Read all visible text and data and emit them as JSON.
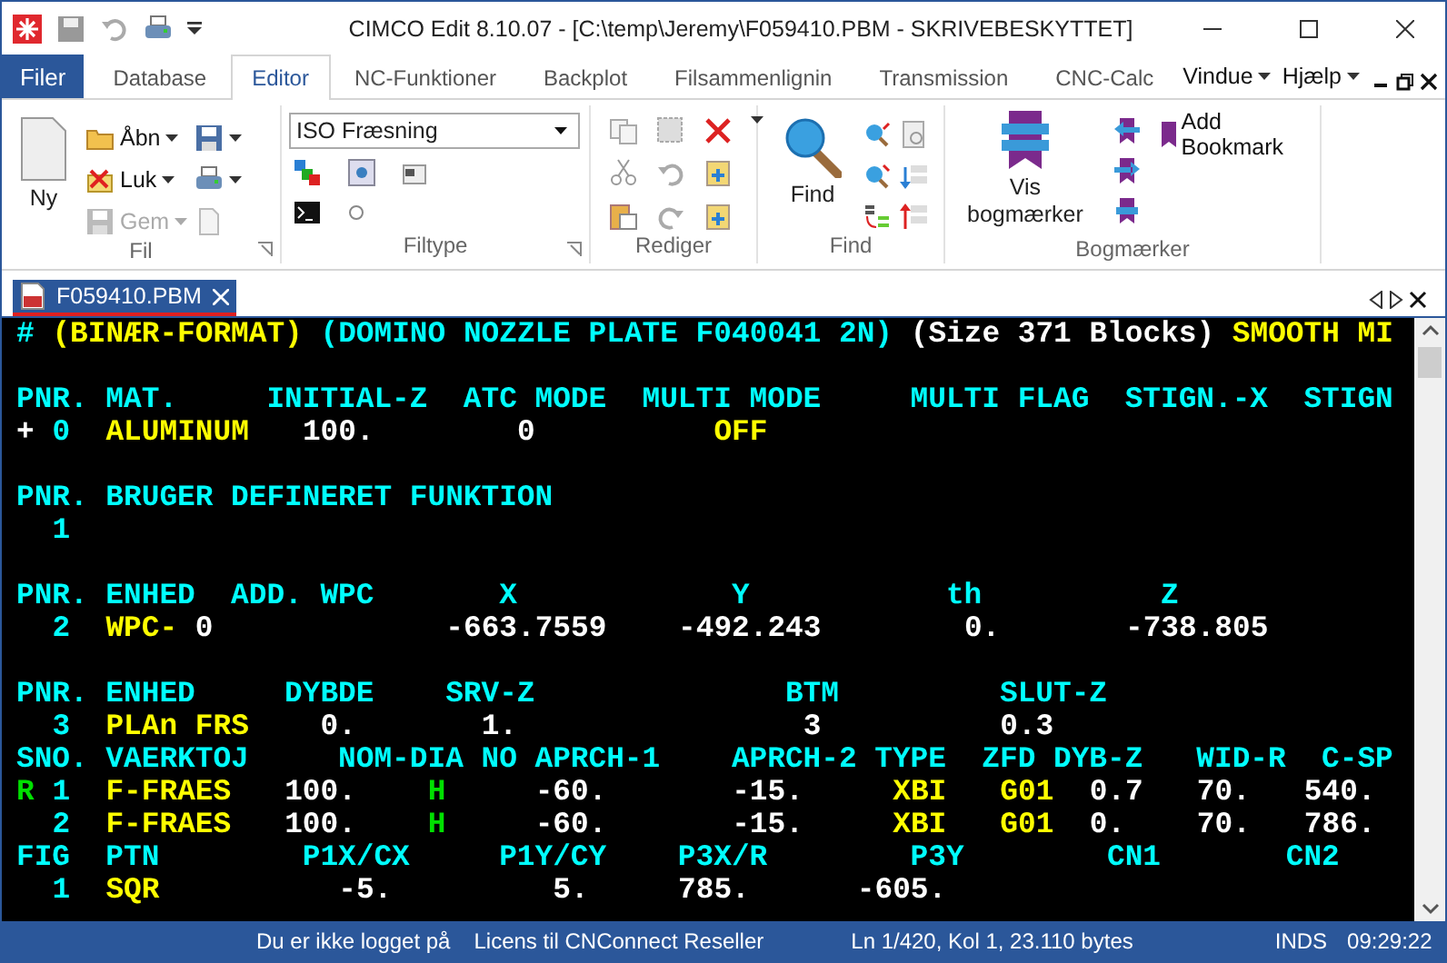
{
  "window": {
    "title": "CIMCO Edit 8.10.07 - [C:\\temp\\Jeremy\\F059410.PBM - SKRIVEBESKYTTET]"
  },
  "ribbon": {
    "file_tab": "Filer",
    "tabs": [
      {
        "label": "Database",
        "selected": false
      },
      {
        "label": "Editor",
        "selected": true
      },
      {
        "label": "NC-Funktioner",
        "selected": false
      },
      {
        "label": "Backplot",
        "selected": false
      },
      {
        "label": "Filsammenlignin",
        "selected": false
      },
      {
        "label": "Transmission",
        "selected": false
      },
      {
        "label": "CNC-Calc",
        "selected": false
      }
    ],
    "menus": [
      "Vindue",
      "Hjælp"
    ],
    "fil": {
      "label": "Fil",
      "new_button": "Ny",
      "buttons": [
        {
          "label": "Åbn",
          "disabled": false
        },
        {
          "label": "Luk",
          "disabled": false
        },
        {
          "label": "Gem",
          "disabled": true
        }
      ]
    },
    "filtype": {
      "label": "Filtype",
      "dropdown_value": "ISO Fræsning"
    },
    "rediger": {
      "label": "Rediger"
    },
    "find": {
      "label": "Find",
      "button": "Find"
    },
    "bogmaerker": {
      "label": "Bogmærker",
      "show_button": [
        "Vis",
        "bogmærker"
      ],
      "add_button": "Add Bookmark"
    }
  },
  "document_tabs": [
    {
      "label": "F059410.PBM",
      "selected": true
    }
  ],
  "editor": {
    "lines": [
      {
        "kind": "code",
        "segments": [
          {
            "text": "#",
            "color": "#00ffff"
          },
          {
            "text": " (BINÆR-FORMAT)",
            "color": "#ffff00"
          },
          {
            "text": " (DOMINO NOZZLE PLATE F040041 2N)",
            "color": "#00ffff"
          },
          {
            "text": " (Size 371 Blocks)",
            "color": "#ffffff"
          },
          {
            "text": " SMOOTH MI",
            "color": "#ffff00"
          }
        ]
      },
      {
        "kind": "blank"
      },
      {
        "kind": "code",
        "segments": [
          {
            "text": "PNR. MAT.     INITIAL-Z  ATC MODE  MULTI MODE     MULTI FLAG  STIGN.-X  STIGN",
            "color": "#00ffff"
          }
        ]
      },
      {
        "kind": "code",
        "segments": [
          {
            "text": "+",
            "color": "#ffffff"
          },
          {
            "text": " 0",
            "color": "#00ffff"
          },
          {
            "text": "  ALUMINUM",
            "color": "#ffff00"
          },
          {
            "text": "   100.",
            "color": "#ffffff"
          },
          {
            "text": "        0",
            "color": "#ffffff"
          },
          {
            "text": "          OFF",
            "color": "#ffff00"
          }
        ]
      },
      {
        "kind": "blank"
      },
      {
        "kind": "code",
        "segments": [
          {
            "text": "PNR. BRUGER DEFINERET FUNKTION",
            "color": "#00ffff"
          }
        ]
      },
      {
        "kind": "code",
        "segments": [
          {
            "text": "  1",
            "color": "#00ffff"
          }
        ]
      },
      {
        "kind": "blank"
      },
      {
        "kind": "code",
        "segments": [
          {
            "text": "PNR. ENHED  ADD. WPC       X            Y           th          Z",
            "color": "#00ffff"
          }
        ]
      },
      {
        "kind": "code",
        "segments": [
          {
            "text": "  2",
            "color": "#00ffff"
          },
          {
            "text": "  WPC-",
            "color": "#ffff00"
          },
          {
            "text": " 0",
            "color": "#ffffff"
          },
          {
            "text": "             -663.7559",
            "color": "#ffffff"
          },
          {
            "text": "    -492.243",
            "color": "#ffffff"
          },
          {
            "text": "        0.",
            "color": "#ffffff"
          },
          {
            "text": "       -738.805",
            "color": "#ffffff"
          }
        ]
      },
      {
        "kind": "blank"
      },
      {
        "kind": "code",
        "segments": [
          {
            "text": "PNR. ENHED     DYBDE    SRV-Z              BTM         SLUT-Z",
            "color": "#00ffff"
          }
        ]
      },
      {
        "kind": "code",
        "segments": [
          {
            "text": "  3",
            "color": "#00ffff"
          },
          {
            "text": "  PLAn FRS",
            "color": "#ffff00"
          },
          {
            "text": "    0.",
            "color": "#ffffff"
          },
          {
            "text": "       1.",
            "color": "#ffffff"
          },
          {
            "text": "                3",
            "color": "#ffffff"
          },
          {
            "text": "          0.3",
            "color": "#ffffff"
          }
        ]
      },
      {
        "kind": "code",
        "segments": [
          {
            "text": "SNO. VAERKTOJ     NOM-DIA NO APRCH-1    APRCH-2 TYPE  ZFD DYB-Z   WID-R  C-SP",
            "color": "#00ffff"
          }
        ]
      },
      {
        "kind": "code",
        "segments": [
          {
            "text": "R",
            "color": "#00e000"
          },
          {
            "text": " 1",
            "color": "#00ffff"
          },
          {
            "text": "  F-FRAES",
            "color": "#ffff00"
          },
          {
            "text": "   100.",
            "color": "#ffffff"
          },
          {
            "text": "    H",
            "color": "#00e000"
          },
          {
            "text": "     -60.",
            "color": "#ffffff"
          },
          {
            "text": "       -15.",
            "color": "#ffffff"
          },
          {
            "text": "     XBI",
            "color": "#ffff00"
          },
          {
            "text": "   G01",
            "color": "#ffff00"
          },
          {
            "text": "  0.7",
            "color": "#ffffff"
          },
          {
            "text": "   70.",
            "color": "#ffffff"
          },
          {
            "text": "   540.",
            "color": "#ffffff"
          }
        ]
      },
      {
        "kind": "code",
        "segments": [
          {
            "text": "  2",
            "color": "#00ffff"
          },
          {
            "text": "  F-FRAES",
            "color": "#ffff00"
          },
          {
            "text": "   100.",
            "color": "#ffffff"
          },
          {
            "text": "    H",
            "color": "#00e000"
          },
          {
            "text": "     -60.",
            "color": "#ffffff"
          },
          {
            "text": "       -15.",
            "color": "#ffffff"
          },
          {
            "text": "     XBI",
            "color": "#ffff00"
          },
          {
            "text": "   G01",
            "color": "#ffff00"
          },
          {
            "text": "  0.",
            "color": "#ffffff"
          },
          {
            "text": "    70.",
            "color": "#ffffff"
          },
          {
            "text": "   786.",
            "color": "#ffffff"
          }
        ]
      },
      {
        "kind": "code",
        "segments": [
          {
            "text": "FIG  PTN        P1X/CX     P1Y/CY    P3X/R        P3Y        CN1       CN2",
            "color": "#00ffff"
          }
        ]
      },
      {
        "kind": "code",
        "segments": [
          {
            "text": "  1",
            "color": "#00ffff"
          },
          {
            "text": "  SQR",
            "color": "#ffff00"
          },
          {
            "text": "          -5.",
            "color": "#ffffff"
          },
          {
            "text": "         5.",
            "color": "#ffffff"
          },
          {
            "text": "     785.",
            "color": "#ffffff"
          },
          {
            "text": "      -605.",
            "color": "#ffffff"
          }
        ]
      }
    ]
  },
  "status_bar": [
    "Du er ikke logget på",
    "Licens til CNConnect Reseller",
    "Ln 1/420, Kol 1, 23.110 bytes",
    "INDS",
    "09:29:22"
  ]
}
